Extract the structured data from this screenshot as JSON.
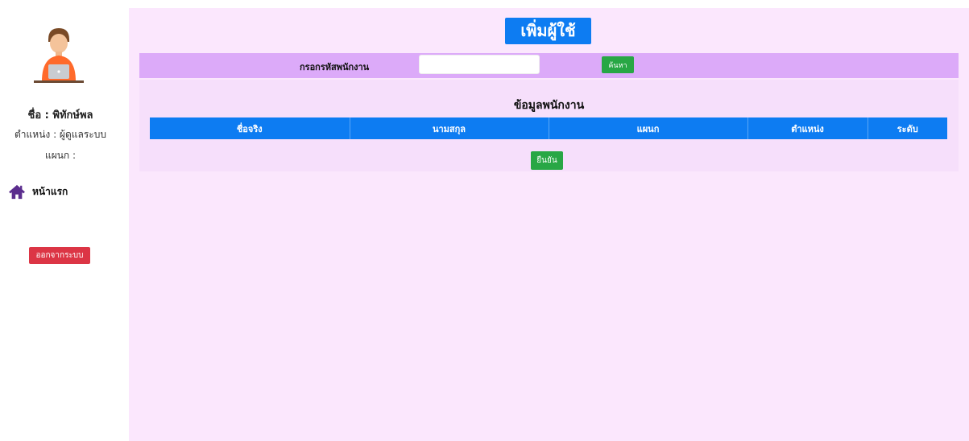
{
  "sidebar": {
    "profile_name": "ชื่อ : พิทักษ์พล",
    "profile_position": "ตำแหน่ง : ผู้ดูแลระบบ",
    "profile_department": "แผนก :",
    "nav_home_label": "หน้าแรก",
    "logout_label": "ออกจากระบบ",
    "nav_home_icon": "home-icon",
    "avatar_icon": "user-at-laptop-icon"
  },
  "main": {
    "title": "เพิ่มผู้ใช้",
    "search": {
      "label": "กรอกรหัสพนักงาน",
      "value": "",
      "placeholder": "",
      "button_label": "ค้นหา"
    },
    "data_heading": "ข้อมูลพนักงาน",
    "table_headers": [
      "ชื่อจริง",
      "นามสกุล",
      "แผนก",
      "ตำแหน่ง",
      "ระดับ"
    ],
    "confirm_label": "ยืนยัน"
  },
  "colors": {
    "main_background": "#fbe7fd",
    "search_bar_background": "#dcaaf9",
    "panel_background": "#f6dffb",
    "primary_blue": "#0d7cf2",
    "success_green": "#28a745",
    "danger_red": "#dc3545",
    "home_icon_color": "#5b2d8e"
  }
}
